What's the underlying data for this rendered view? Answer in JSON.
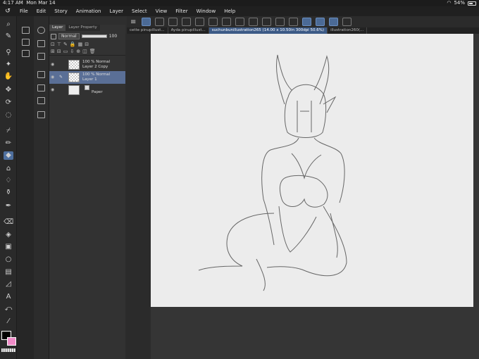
{
  "status": {
    "time": "4:17 AM",
    "date": "Mon Mar 14",
    "battery": "54%"
  },
  "menu": [
    "File",
    "Edit",
    "Story",
    "Animation",
    "Layer",
    "Select",
    "View",
    "Filter",
    "Window",
    "Help"
  ],
  "tabs": [
    {
      "label": "cette pinupillust...",
      "active": false
    },
    {
      "label": "Ayda pinupillust...",
      "active": false
    },
    {
      "label": "suchunbunillustration265 (14.00 x 10.50in 300dpi 50.6%)",
      "active": true
    },
    {
      "label": "illustration260(...",
      "active": false
    }
  ],
  "panel": {
    "tab_layer": "Layer",
    "tab_props": "Layer Property",
    "blend_mode": "Normal",
    "opacity": "100"
  },
  "layers": [
    {
      "line1": "100 % Normal",
      "line2": "Layer 2 Copy",
      "selected": false
    },
    {
      "line1": "100 % Normal",
      "line2": "Layer 1",
      "selected": true
    },
    {
      "line1": "",
      "line2": "Paper",
      "selected": false
    }
  ],
  "colors": {
    "main": "#000000",
    "sub": "#f08cc8",
    "accent": "#4b6a96"
  }
}
